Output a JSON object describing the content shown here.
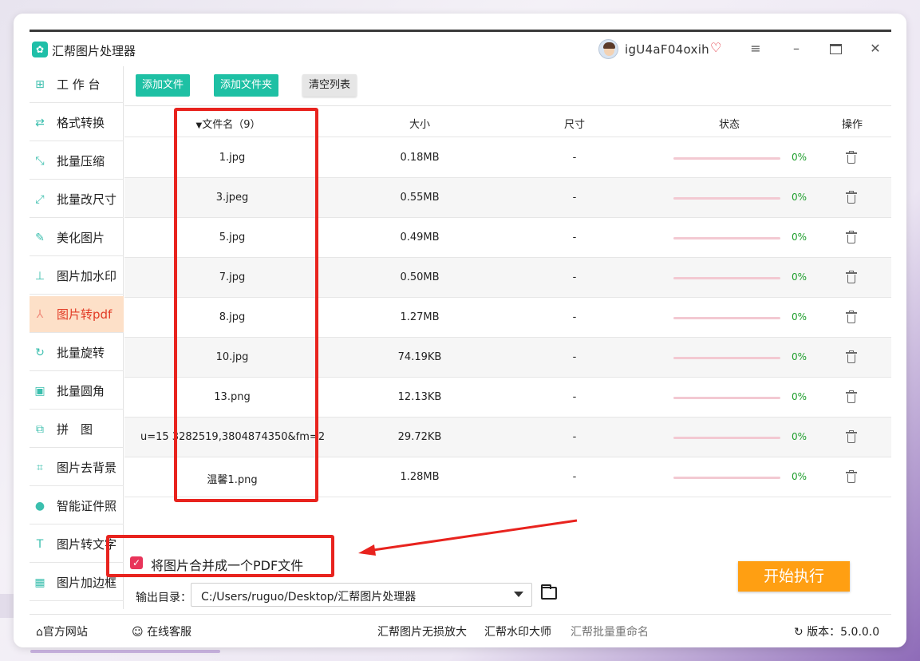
{
  "app": {
    "title": "汇帮图片处理器",
    "username": "igU4aF04oxih"
  },
  "sidebar": {
    "items": [
      {
        "label": "工 作 台",
        "icon": "⊞",
        "name": "workbench"
      },
      {
        "label": "格式转换",
        "icon": "⇄",
        "name": "format-convert"
      },
      {
        "label": "批量压缩",
        "icon": "⤡",
        "name": "batch-compress"
      },
      {
        "label": "批量改尺寸",
        "icon": "⤢",
        "name": "batch-resize"
      },
      {
        "label": "美化图片",
        "icon": "✎",
        "name": "beautify"
      },
      {
        "label": "图片加水印",
        "icon": "⊥",
        "name": "watermark"
      },
      {
        "label": "图片转pdf",
        "icon": "⅄",
        "name": "image-to-pdf"
      },
      {
        "label": "批量旋转",
        "icon": "↻",
        "name": "batch-rotate"
      },
      {
        "label": "批量圆角",
        "icon": "▣",
        "name": "batch-round"
      },
      {
        "label": "拼　图",
        "icon": "⧉",
        "name": "collage"
      },
      {
        "label": "图片去背景",
        "icon": "⌗",
        "name": "remove-bg"
      },
      {
        "label": "智能证件照",
        "icon": "●",
        "name": "id-photo"
      },
      {
        "label": "图片转文字",
        "icon": "T",
        "name": "image-to-text"
      },
      {
        "label": "图片加边框",
        "icon": "▦",
        "name": "add-border"
      }
    ],
    "active_index": 6
  },
  "toolbar": {
    "add_file": "添加文件",
    "add_folder": "添加文件夹",
    "clear_list": "清空列表"
  },
  "table": {
    "headers": {
      "filename": "文件名（9）",
      "size": "大小",
      "dimensions": "尺寸",
      "status": "状态",
      "action": "操作"
    },
    "rows": [
      {
        "name": "1.jpg",
        "size": "0.18MB",
        "dim": "-",
        "pct": "0%"
      },
      {
        "name": "3.jpeg",
        "size": "0.55MB",
        "dim": "-",
        "pct": "0%"
      },
      {
        "name": "5.jpg",
        "size": "0.49MB",
        "dim": "-",
        "pct": "0%"
      },
      {
        "name": "7.jpg",
        "size": "0.50MB",
        "dim": "-",
        "pct": "0%"
      },
      {
        "name": "8.jpg",
        "size": "1.27MB",
        "dim": "-",
        "pct": "0%"
      },
      {
        "name": "10.jpg",
        "size": "74.19KB",
        "dim": "-",
        "pct": "0%"
      },
      {
        "name": "13.png",
        "size": "12.13KB",
        "dim": "-",
        "pct": "0%"
      },
      {
        "name": "u=15 3282519,3804874350&fm=2...",
        "size": "29.72KB",
        "dim": "-",
        "pct": "0%"
      },
      {
        "name": "温馨1.png",
        "size": "1.28MB",
        "dim": "-",
        "pct": "0%"
      }
    ]
  },
  "merge": {
    "checked": true,
    "label": "将图片合并成一个PDF文件"
  },
  "output": {
    "label": "输出目录：",
    "path": "C:/Users/ruguo/Desktop/汇帮图片处理器"
  },
  "start_button": "开始执行",
  "footer": {
    "website": "官方网站",
    "support": "在线客服",
    "link1": "汇帮图片无损放大",
    "link2": "汇帮水印大师",
    "link3": "汇帮批量重命名",
    "version": "版本：5.0.0.0"
  },
  "colors": {
    "accent": "#1ec0a4",
    "active_bg": "#fde0c8",
    "active_text": "#e23b25",
    "start": "#ff9f12",
    "annotation": "#e8231e",
    "progress": "#f3c9d2",
    "percent": "#1e9e2c"
  }
}
